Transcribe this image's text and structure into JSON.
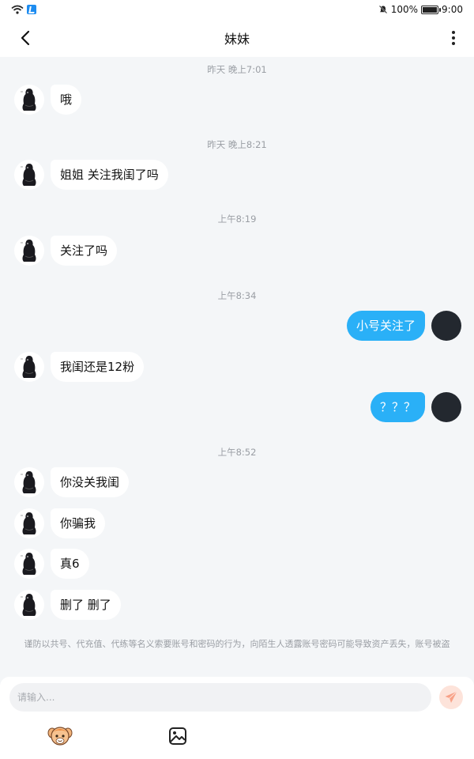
{
  "status_bar": {
    "battery": "100%",
    "time": "9:00",
    "battery_level": 1.0
  },
  "header": {
    "title": "妹妹"
  },
  "chat": {
    "items": [
      {
        "type": "timestamp",
        "text": "昨天 晚上7:01"
      },
      {
        "type": "message",
        "side": "left",
        "text": "哦"
      },
      {
        "type": "timestamp",
        "text": "昨天 晚上8:21"
      },
      {
        "type": "message",
        "side": "left",
        "text": "姐姐 关注我闺了吗"
      },
      {
        "type": "timestamp",
        "text": "上午8:19"
      },
      {
        "type": "message",
        "side": "left",
        "text": "关注了吗"
      },
      {
        "type": "timestamp",
        "text": "上午8:34"
      },
      {
        "type": "message",
        "side": "right",
        "text": "小号关注了"
      },
      {
        "type": "message",
        "side": "left",
        "text": "我闺还是12粉"
      },
      {
        "type": "message",
        "side": "right",
        "text": "？？？"
      },
      {
        "type": "timestamp",
        "text": "上午8:52"
      },
      {
        "type": "message",
        "side": "left",
        "text": "你没关我闺"
      },
      {
        "type": "message",
        "side": "left",
        "text": "你骗我"
      },
      {
        "type": "message",
        "side": "left",
        "text": "真6"
      },
      {
        "type": "message",
        "side": "left",
        "text": "删了  删了"
      }
    ],
    "warning": "谨防以共号、代充值、代练等名义索要账号和密码的行为，向陌生人透露账号密码可能导致资产丢失，账号被盗"
  },
  "input": {
    "placeholder": "请输入..."
  },
  "colors": {
    "accent_bubble": "#2ab0f7",
    "send_button_bg": "#fde3da",
    "send_icon": "#f8a187",
    "chat_background": "#f4f6f8"
  },
  "icons": {
    "back": "chevron-left-icon",
    "more": "more-vertical-icon",
    "send": "paper-plane-icon",
    "emoji": "emoji-face-icon",
    "image": "image-icon"
  }
}
